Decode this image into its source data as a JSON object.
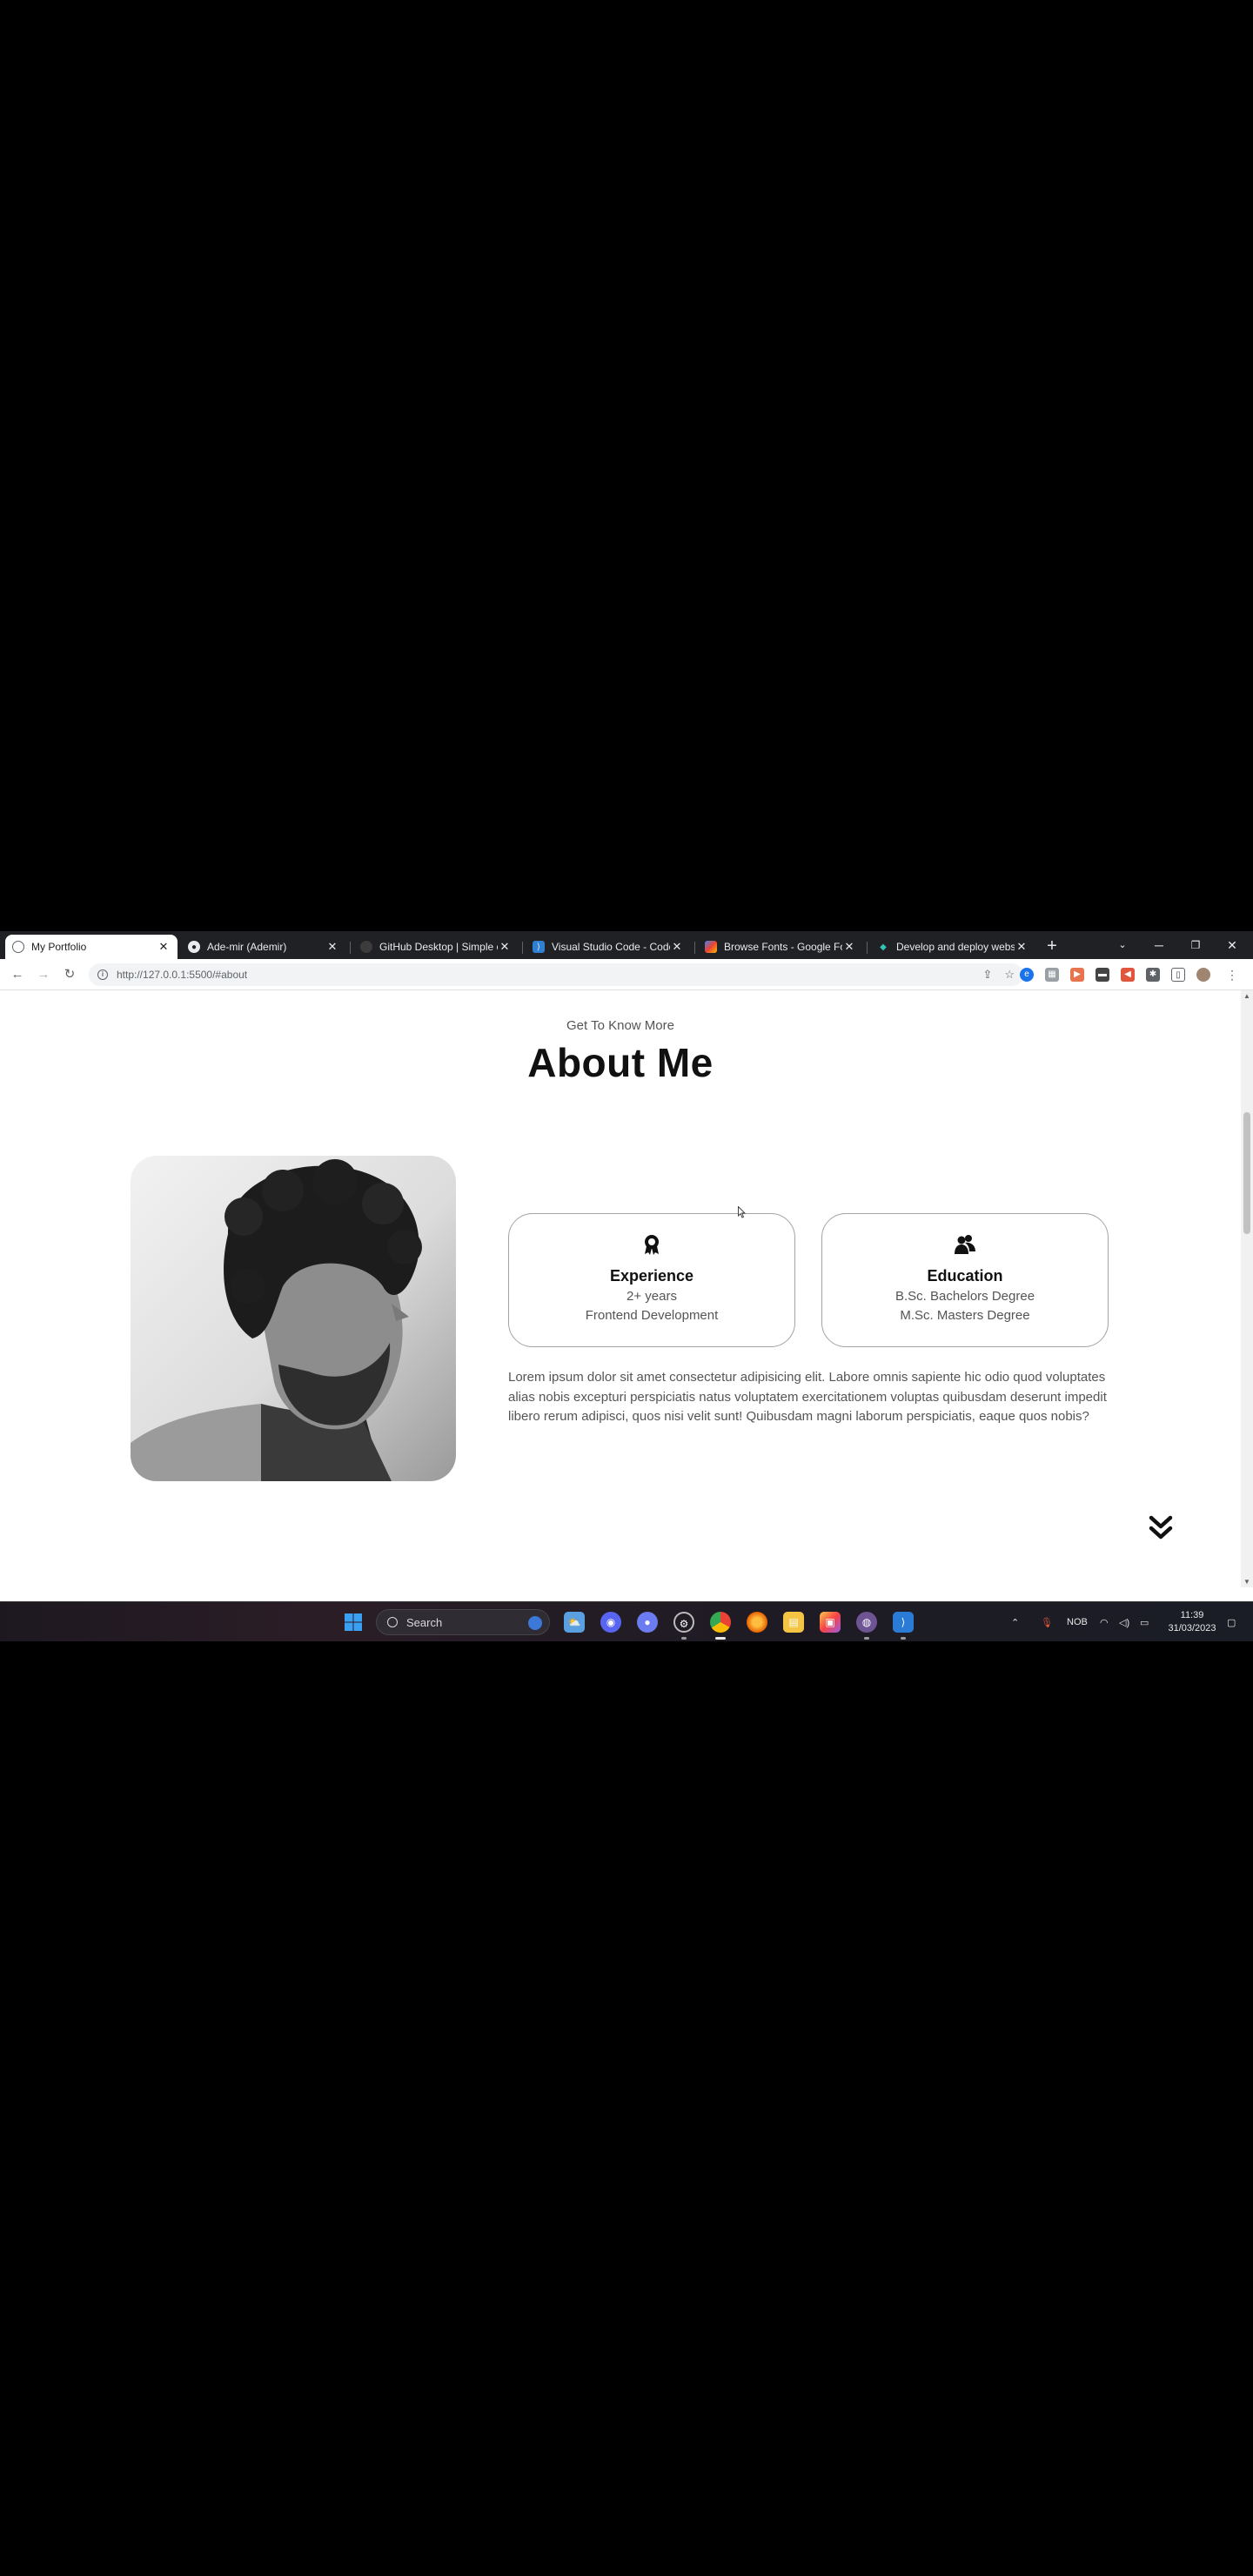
{
  "browser": {
    "tabs": [
      {
        "title": "My Portfolio",
        "icon": "globe-icon",
        "active": true
      },
      {
        "title": "Ade-mir (Ademir)",
        "icon": "github-icon",
        "active": false
      },
      {
        "title": "GitHub Desktop | Simple co",
        "icon": "github-desktop-icon",
        "active": false
      },
      {
        "title": "Visual Studio Code - Code",
        "icon": "vscode-icon",
        "active": false
      },
      {
        "title": "Browse Fonts - Google Fon",
        "icon": "google-fonts-icon",
        "active": false
      },
      {
        "title": "Develop and deploy websi",
        "icon": "netlify-icon",
        "active": false
      }
    ],
    "url": "http://127.0.0.1:5500/#about"
  },
  "page": {
    "subtitle": "Get To Know More",
    "title": "About Me",
    "cards": [
      {
        "icon": "award-icon",
        "title": "Experience",
        "lines": [
          "2+ years",
          "Frontend Development"
        ]
      },
      {
        "icon": "education-icon",
        "title": "Education",
        "lines": [
          "B.Sc. Bachelors Degree",
          "M.Sc. Masters Degree"
        ]
      }
    ],
    "about_text": "Lorem ipsum dolor sit amet consectetur adipisicing elit. Labore omnis sapiente hic odio quod voluptates alias nobis excepturi perspiciatis natus voluptatem exercitationem voluptas quibusdam deserunt impedit libero rerum adipisci, quos nisi velit sunt! Quibusdam magni laborum perspiciatis, eaque quos nobis?"
  },
  "taskbar": {
    "search_placeholder": "Search",
    "language": "NOB",
    "time": "11:39",
    "date": "31/03/2023"
  },
  "colors": {
    "accent": "#111111",
    "card_border": "#a3a3a3",
    "taskbar": "#1d1820"
  }
}
